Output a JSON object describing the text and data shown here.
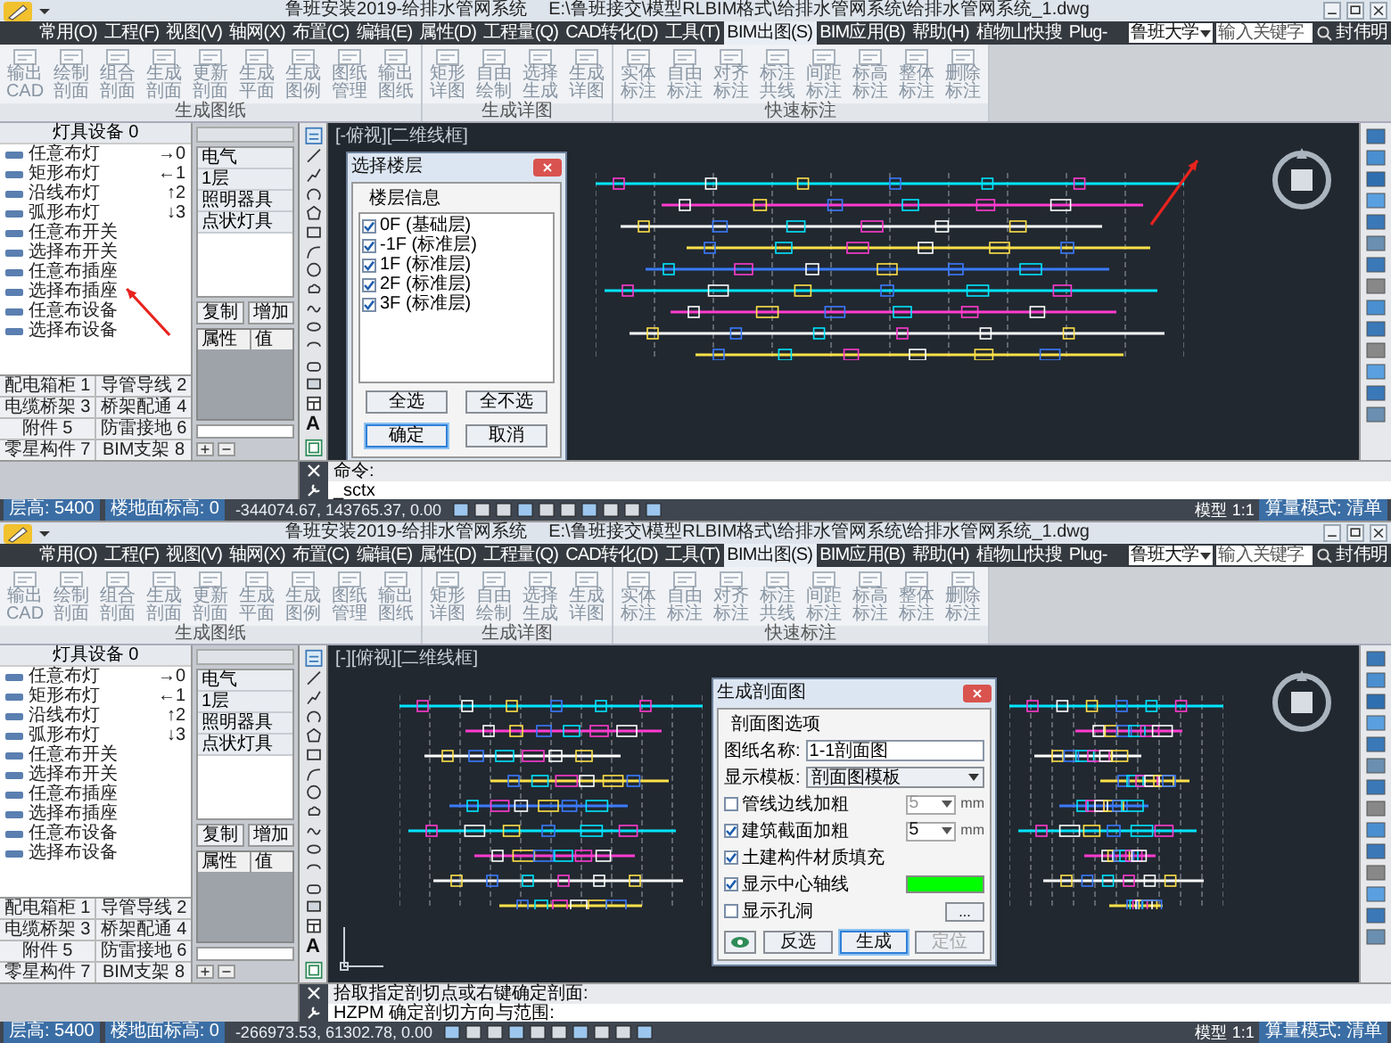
{
  "screens": [
    {
      "title": "鲁班安装2019-给排水管网系统",
      "file_path": "E:\\鲁班接交\\模型RLBIM格式\\给排水管网系统\\给排水管网系统_1.dwg",
      "menu": [
        {
          "label": "常用(O)",
          "selected": false
        },
        {
          "label": "工程(F)",
          "selected": false
        },
        {
          "label": "视图(V)",
          "selected": false
        },
        {
          "label": "轴网(X)",
          "selected": false
        },
        {
          "label": "布置(C)",
          "selected": false
        },
        {
          "label": "编辑(E)",
          "selected": false
        },
        {
          "label": "属性(D)",
          "selected": false
        },
        {
          "label": "工程量(Q)",
          "selected": false
        },
        {
          "label": "CAD转化(D)",
          "selected": false
        },
        {
          "label": "工具(T)",
          "selected": false
        },
        {
          "label": "BIM出图(S)",
          "selected": true
        },
        {
          "label": "BIM应用(B)",
          "selected": false
        },
        {
          "label": "帮助(H)",
          "selected": false
        },
        {
          "label": "植物山快搜",
          "selected": false
        },
        {
          "label": "Plug-",
          "selected": false
        }
      ],
      "university": "鲁班大学",
      "search": {
        "placeholder": "输入关键字"
      },
      "user": "封伟明",
      "ribbon_groups": [
        {
          "label": "生成图纸",
          "buttons": [
            "输出CAD",
            "绘制剖面",
            "组合剖面",
            "生成剖面",
            "更新剖面",
            "生成平面",
            "生成图例",
            "图纸管理",
            "输出图纸"
          ]
        },
        {
          "label": "生成详图",
          "buttons": [
            "矩形详图",
            "自由绘制",
            "选择生成",
            "生成详图"
          ]
        },
        {
          "label": "快速标注",
          "buttons": [
            "实体标注",
            "自由标注",
            "对齐标注",
            "标注共线",
            "间距标注",
            "标高标注",
            "整体标注",
            "删除标注"
          ]
        }
      ],
      "left_panel": {
        "header": "灯具设备 0",
        "items": [
          {
            "label": "任意布灯",
            "key": "→0"
          },
          {
            "label": "矩形布灯",
            "key": "←1"
          },
          {
            "label": "沿线布灯",
            "key": "↑2"
          },
          {
            "label": "弧形布灯",
            "key": "↓3"
          },
          {
            "label": "任意布开关"
          },
          {
            "label": "选择布开关"
          },
          {
            "label": "任意布插座"
          },
          {
            "label": "选择布插座"
          },
          {
            "label": "任意布设备"
          },
          {
            "label": "选择布设备"
          }
        ],
        "categories": [
          "配电箱柜 1",
          "导管导线 2",
          "电缆桥架 3",
          "桥架配通 4",
          "附件 5",
          "防雷接地 6",
          "零星构件 7",
          "BIM支架 8"
        ]
      },
      "tree": {
        "items": [
          "电气",
          "1层",
          "照明器具",
          "点状灯具"
        ],
        "buttons": [
          "复制",
          "增加"
        ],
        "columns": [
          "属性",
          "值"
        ]
      },
      "text_tool": "A",
      "canvas": {
        "view_label": "[-俯视][二维线框]"
      },
      "dialog": {
        "kind": "floor_select",
        "title": "选择楼层",
        "group": "楼层信息",
        "floors": [
          {
            "label": "0F (基础层)",
            "checked": true
          },
          {
            "label": "-1F (标准层)",
            "checked": true
          },
          {
            "label": "1F (标准层)",
            "checked": true
          },
          {
            "label": "2F (标准层)",
            "checked": true
          },
          {
            "label": "3F (标准层)",
            "checked": true
          }
        ],
        "buttons": [
          {
            "label": "全选",
            "default": false
          },
          {
            "label": "全不选",
            "default": false
          },
          {
            "label": "确定",
            "default": true
          },
          {
            "label": "取消",
            "default": false
          }
        ]
      },
      "command_lines": [
        "命令:",
        "_sctx"
      ],
      "status_bar": {
        "fields": [
          "层高: 5400",
          "楼地面标高: 0"
        ],
        "coordinates": "-344074.67, 143765.37, 0.00",
        "mode_tab": "模型",
        "scale": "1:1",
        "calc_mode": "算量模式: 清单"
      }
    },
    {
      "title": "鲁班安装2019-给排水管网系统",
      "file_path": "E:\\鲁班接交\\模型RLBIM格式\\给排水管网系统\\给排水管网系统_1.dwg",
      "menu": [
        {
          "label": "常用(O)",
          "selected": false
        },
        {
          "label": "工程(F)",
          "selected": false
        },
        {
          "label": "视图(V)",
          "selected": false
        },
        {
          "label": "轴网(X)",
          "selected": false
        },
        {
          "label": "布置(C)",
          "selected": false
        },
        {
          "label": "编辑(E)",
          "selected": false
        },
        {
          "label": "属性(D)",
          "selected": false
        },
        {
          "label": "工程量(Q)",
          "selected": false
        },
        {
          "label": "CAD转化(D)",
          "selected": false
        },
        {
          "label": "工具(T)",
          "selected": false
        },
        {
          "label": "BIM出图(S)",
          "selected": true
        },
        {
          "label": "BIM应用(B)",
          "selected": false
        },
        {
          "label": "帮助(H)",
          "selected": false
        },
        {
          "label": "植物山快搜",
          "selected": false
        },
        {
          "label": "Plug-",
          "selected": false
        }
      ],
      "university": "鲁班大学",
      "search": {
        "placeholder": "输入关键字"
      },
      "user": "封伟明",
      "ribbon_groups": [
        {
          "label": "生成图纸",
          "buttons": [
            "输出CAD",
            "绘制剖面",
            "组合剖面",
            "生成剖面",
            "更新剖面",
            "生成平面",
            "生成图例",
            "图纸管理",
            "输出图纸"
          ]
        },
        {
          "label": "生成详图",
          "buttons": [
            "矩形详图",
            "自由绘制",
            "选择生成",
            "生成详图"
          ]
        },
        {
          "label": "快速标注",
          "buttons": [
            "实体标注",
            "自由标注",
            "对齐标注",
            "标注共线",
            "间距标注",
            "标高标注",
            "整体标注",
            "删除标注"
          ]
        }
      ],
      "left_panel": {
        "header": "灯具设备 0",
        "items": [
          {
            "label": "任意布灯",
            "key": "→0"
          },
          {
            "label": "矩形布灯",
            "key": "←1"
          },
          {
            "label": "沿线布灯",
            "key": "↑2"
          },
          {
            "label": "弧形布灯",
            "key": "↓3"
          },
          {
            "label": "任意布开关"
          },
          {
            "label": "选择布开关"
          },
          {
            "label": "任意布插座"
          },
          {
            "label": "选择布插座"
          },
          {
            "label": "任意布设备"
          },
          {
            "label": "选择布设备"
          }
        ],
        "categories": [
          "配电箱柜 1",
          "导管导线 2",
          "电缆桥架 3",
          "桥架配通 4",
          "附件 5",
          "防雷接地 6",
          "零星构件 7",
          "BIM支架 8"
        ]
      },
      "tree": {
        "items": [
          "电气",
          "1层",
          "照明器具",
          "点状灯具"
        ],
        "buttons": [
          "复制",
          "增加"
        ],
        "columns": [
          "属性",
          "值"
        ]
      },
      "text_tool": "A",
      "canvas": {
        "view_label": "[-][俯视][二维线框]"
      },
      "dialog": {
        "kind": "section",
        "title": "生成剖面图",
        "group": "剖面图选项",
        "fields": [
          {
            "kind": "text",
            "label": "图纸名称:",
            "value": "1-1剖面图"
          },
          {
            "kind": "select",
            "label": "显示模板:",
            "value": "剖面图模板"
          }
        ],
        "options": [
          {
            "label": "管线边线加粗",
            "checked": false,
            "size": "5",
            "unit": "mm"
          },
          {
            "label": "建筑截面加粗",
            "checked": true,
            "size": "5",
            "unit": "mm"
          },
          {
            "label": "土建构件材质填充",
            "checked": true
          },
          {
            "label": "显示中心轴线",
            "checked": true,
            "color": "#00ff00"
          },
          {
            "label": "显示孔洞",
            "checked": false,
            "browse": "..."
          }
        ],
        "buttons": [
          {
            "label": "反选",
            "default": false,
            "disabled": false
          },
          {
            "label": "生成",
            "default": true,
            "disabled": false
          },
          {
            "label": "定位",
            "default": false,
            "disabled": true
          }
        ]
      },
      "command_lines": [
        "拾取指定剖切点或右键确定剖面:",
        "HZPM 确定剖切方向与范围:"
      ],
      "status_bar": {
        "fields": [
          "层高: 5400",
          "楼地面标高: 0"
        ],
        "coordinates": "-266973.53, 61302.78, 0.00",
        "mode_tab": "模型",
        "scale": "1:1",
        "calc_mode": "算量模式: 清单"
      }
    }
  ]
}
